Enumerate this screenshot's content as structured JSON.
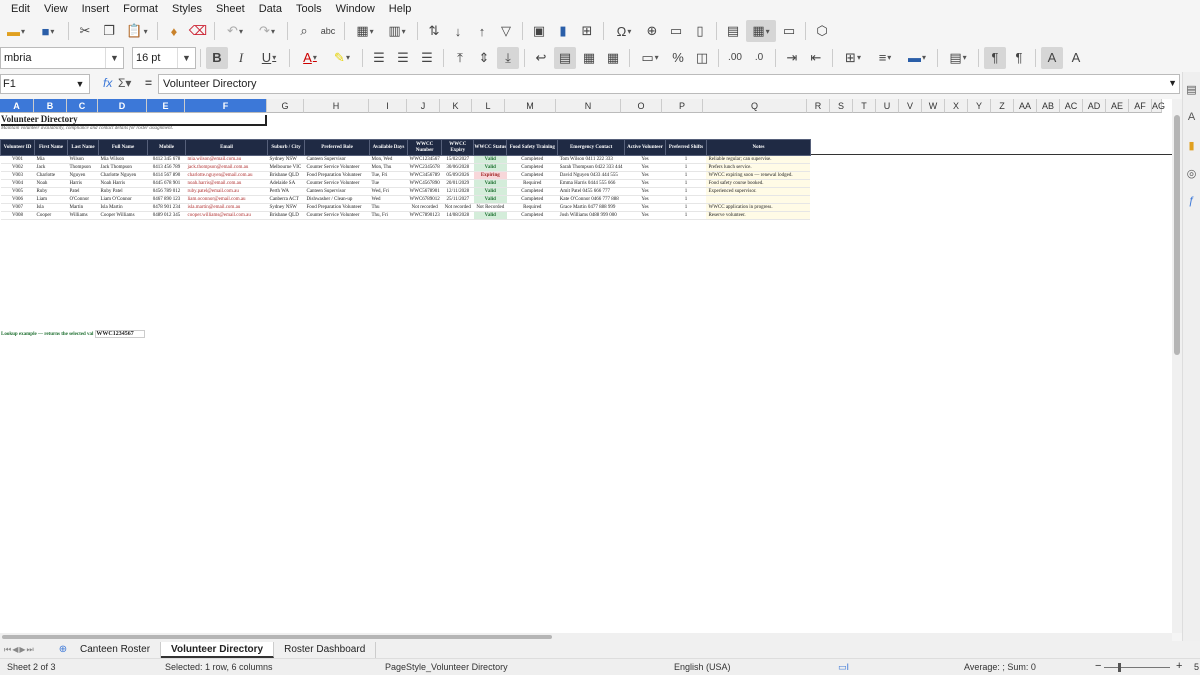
{
  "menu": [
    "Edit",
    "View",
    "Insert",
    "Format",
    "Styles",
    "Sheet",
    "Data",
    "Tools",
    "Window",
    "Help"
  ],
  "font": {
    "name": "mbria",
    "size": "16 pt"
  },
  "name_box": "F1",
  "formula": "Volunteer Directory",
  "columns": [
    "A",
    "B",
    "C",
    "D",
    "E",
    "F",
    "G",
    "H",
    "I",
    "J",
    "K",
    "L",
    "M",
    "N",
    "O",
    "P",
    "Q",
    "R",
    "S",
    "T",
    "U",
    "V",
    "W",
    "X",
    "Y",
    "Z",
    "AA",
    "AB",
    "AC",
    "AD",
    "AE",
    "AF",
    "AG"
  ],
  "sheet": {
    "title": "Volunteer Directory",
    "subtitle": "Maintain volunteer availability, compliance and contact details for roster assignment.",
    "headers": [
      "Volunteer ID",
      "First Name",
      "Last Name",
      "Full Name",
      "Mobile",
      "Email",
      "Suburb / City",
      "Preferred Role",
      "Available Days",
      "WWCC Number",
      "WWCC Expiry",
      "WWCC Status",
      "Food Safety Training",
      "Emergency Contact",
      "Active Volunteer",
      "Preferred Shifts",
      "Notes"
    ],
    "rows": [
      [
        "V001",
        "Mia",
        "Wilson",
        "Mia Wilson",
        "0412 345 678",
        "mia.wilson@email.com.au",
        "Sydney NSW",
        "Canteen Supervisor",
        "Mon, Wed",
        "WWC1234567",
        "15/02/2027",
        "Valid",
        "Completed",
        "Tom Wilson 0411 222 333",
        "Yes",
        "1",
        "Reliable regular; can supervise."
      ],
      [
        "V002",
        "Jack",
        "Thompson",
        "Jack Thompson",
        "0413 456 789",
        "jack.thompson@email.com.au",
        "Melbourne VIC",
        "Counter Service Volunteer",
        "Mon, Thu",
        "WWC2345678",
        "30/06/2028",
        "Valid",
        "Completed",
        "Sarah Thompson 0422 333 444",
        "Yes",
        "1",
        "Prefers lunch service."
      ],
      [
        "V003",
        "Charlotte",
        "Nguyen",
        "Charlotte Nguyen",
        "0414 567 890",
        "charlotte.nguyen@email.com.au",
        "Brisbane QLD",
        "Food Preparation Volunteer",
        "Tue, Fri",
        "WWC3456789",
        "05/09/2026",
        "Expiring",
        "Completed",
        "David Nguyen 0433 444 555",
        "Yes",
        "1",
        "WWCC expiring soon — renewal lodged."
      ],
      [
        "V004",
        "Noah",
        "Harris",
        "Noah Harris",
        "0445 678 901",
        "noah.harris@email.com.au",
        "Adelaide SA",
        "Counter Service Volunteer",
        "Tue",
        "WWC4567890",
        "20/01/2029",
        "Valid",
        "Required",
        "Emma Harris 0444 555 666",
        "Yes",
        "1",
        "Food safety course booked."
      ],
      [
        "V005",
        "Ruby",
        "Patel",
        "Ruby Patel",
        "0456 789 012",
        "ruby.patel@email.com.au",
        "Perth WA",
        "Canteen Supervisor",
        "Wed, Fri",
        "WWC5678901",
        "12/11/2028",
        "Valid",
        "Completed",
        "Amit Patel 0455 666 777",
        "Yes",
        "1",
        "Experienced supervisor."
      ],
      [
        "V006",
        "Liam",
        "O'Connor",
        "Liam O'Connor",
        "0467 890 123",
        "liam.oconnor@email.com.au",
        "Canberra ACT",
        "Dishwasher / Clean-up",
        "Wed",
        "WWC6789012",
        "25/11/2027",
        "Valid",
        "Completed",
        "Kate O'Connor 0466 777 888",
        "Yes",
        "1",
        ""
      ],
      [
        "V007",
        "Isla",
        "Martin",
        "Isla Martin",
        "0478 901 234",
        "isla.martin@email.com.au",
        "Sydney NSW",
        "Food Preparation Volunteer",
        "Thu",
        "Not recorded",
        "Not recorded",
        "Not Recorded",
        "Required",
        "Grace Martin 0477 888 999",
        "Yes",
        "1",
        "WWCC application in progress."
      ],
      [
        "V008",
        "Cooper",
        "Williams",
        "Cooper Williams",
        "0489 012 345",
        "cooper.williams@email.com.au",
        "Brisbane QLD",
        "Counter Service Volunteer",
        "Thu, Fri",
        "WWC7890123",
        "14/08/2028",
        "Valid",
        "Completed",
        "Josh Williams 0488 999 000",
        "Yes",
        "1",
        "Reserve volunteer."
      ]
    ],
    "lookup_label": "Lookup example — returns the selected val",
    "lookup_value": "WWC1234567"
  },
  "tabs": [
    "Canteen Roster",
    "Volunteer Directory",
    "Roster Dashboard"
  ],
  "active_tab": "Volunteer Directory",
  "status": {
    "sheet": "Sheet 2 of 3",
    "selection": "Selected: 1 row, 6 columns",
    "page_style": "PageStyle_Volunteer Directory",
    "language": "English (USA)",
    "summary": "Average: ; Sum: 0",
    "zoom_minus": "−",
    "zoom_plus": "+",
    "zoom_value": "5"
  }
}
